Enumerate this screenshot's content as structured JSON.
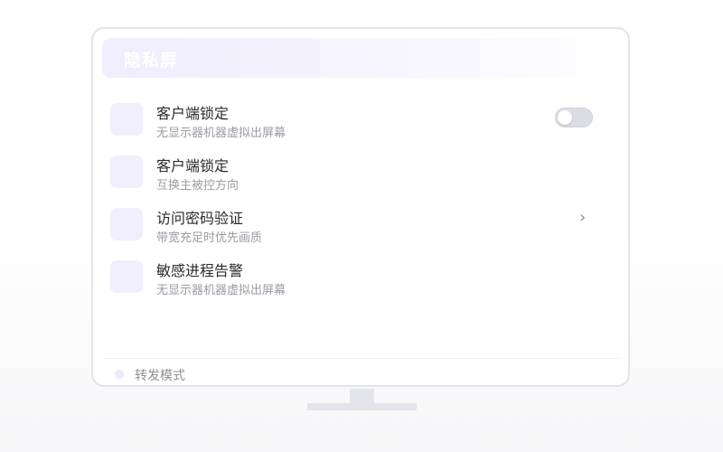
{
  "header": {
    "title": "隐私屏"
  },
  "rows": [
    {
      "title": "客户端锁定",
      "subtitle": "无显示器机器虚拟出屏幕",
      "control": "toggle",
      "toggle_on": false
    },
    {
      "title": "客户端锁定",
      "subtitle": "互换主被控方向",
      "control": "none"
    },
    {
      "title": "访问密码验证",
      "subtitle": "带宽充足时优先画质",
      "control": "chevron",
      "chevron_glyph": "›"
    },
    {
      "title": "敏感进程告警",
      "subtitle": "无显示器机器虚拟出屏幕",
      "control": "none"
    }
  ],
  "footer": {
    "label": "转发模式"
  },
  "colors": {
    "accent_tint": "#f1effd",
    "title_text": "#2a2a2e",
    "subtitle_text": "#9a9ca5",
    "toggle_off": "#dcdde2"
  }
}
